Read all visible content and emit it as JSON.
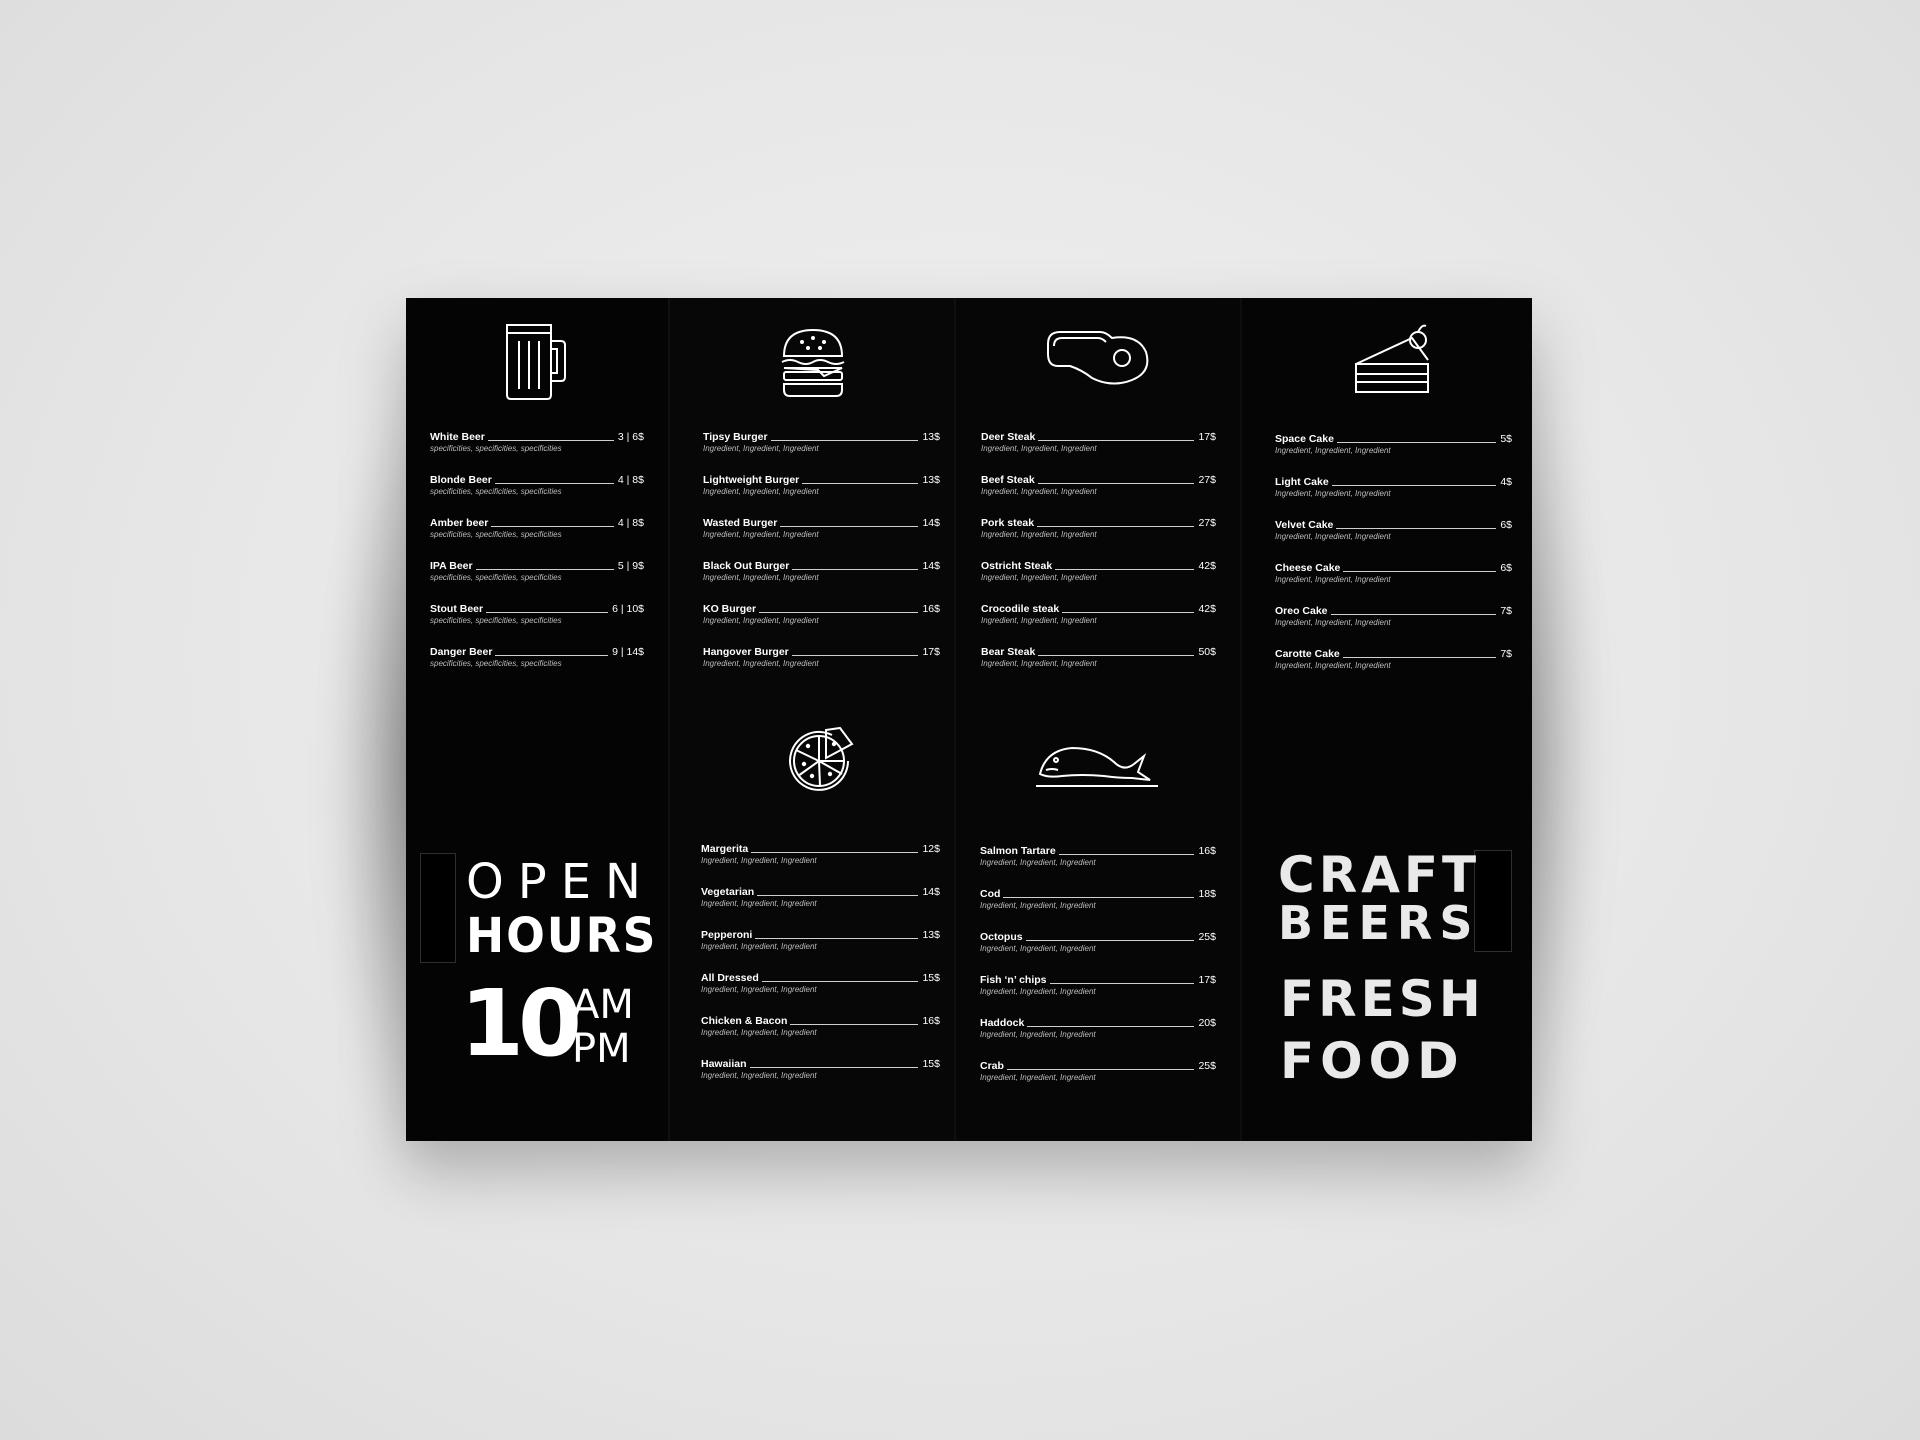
{
  "beers": [
    {
      "name": "White Beer",
      "price": "3 | 6$",
      "desc": "specificities, specificities, specificities"
    },
    {
      "name": "Blonde Beer",
      "price": "4 | 8$",
      "desc": "specificities, specificities, specificities"
    },
    {
      "name": "Amber beer",
      "price": "4 | 8$",
      "desc": "specificities, specificities, specificities"
    },
    {
      "name": "IPA Beer",
      "price": "5 | 9$",
      "desc": "specificities, specificities, specificities"
    },
    {
      "name": "Stout Beer",
      "price": "6 | 10$",
      "desc": "specificities, specificities, specificities"
    },
    {
      "name": "Danger Beer",
      "price": "9 | 14$",
      "desc": "specificities, specificities, specificities"
    }
  ],
  "burgers": [
    {
      "name": "Tipsy Burger",
      "price": "13$",
      "desc": "Ingredient, Ingredient, Ingredient"
    },
    {
      "name": "Lightweight Burger",
      "price": "13$",
      "desc": "Ingredient, Ingredient, Ingredient"
    },
    {
      "name": "Wasted Burger",
      "price": "14$",
      "desc": "Ingredient, Ingredient, Ingredient"
    },
    {
      "name": "Black Out Burger",
      "price": "14$",
      "desc": "Ingredient, Ingredient, Ingredient"
    },
    {
      "name": "KO Burger",
      "price": "16$",
      "desc": "Ingredient, Ingredient, Ingredient"
    },
    {
      "name": "Hangover Burger",
      "price": "17$",
      "desc": "Ingredient, Ingredient, Ingredient"
    }
  ],
  "pizzas": [
    {
      "name": "Margerita",
      "price": "12$",
      "desc": "Ingredient, Ingredient, Ingredient"
    },
    {
      "name": "Vegetarian",
      "price": "14$",
      "desc": "Ingredient, Ingredient, Ingredient"
    },
    {
      "name": "Pepperoni",
      "price": "13$",
      "desc": "Ingredient, Ingredient, Ingredient"
    },
    {
      "name": "All Dressed",
      "price": "15$",
      "desc": "Ingredient, Ingredient, Ingredient"
    },
    {
      "name": "Chicken & Bacon",
      "price": "16$",
      "desc": "Ingredient, Ingredient, Ingredient"
    },
    {
      "name": "Hawaiian",
      "price": "15$",
      "desc": "Ingredient, Ingredient, Ingredient"
    }
  ],
  "steaks": [
    {
      "name": "Deer Steak",
      "price": "17$",
      "desc": "Ingredient, Ingredient, Ingredient"
    },
    {
      "name": "Beef Steak",
      "price": "27$",
      "desc": "Ingredient, Ingredient, Ingredient"
    },
    {
      "name": "Pork steak",
      "price": "27$",
      "desc": "Ingredient, Ingredient, Ingredient"
    },
    {
      "name": "Ostricht Steak",
      "price": "42$",
      "desc": "Ingredient, Ingredient, Ingredient"
    },
    {
      "name": "Crocodile  steak",
      "price": "42$",
      "desc": "Ingredient, Ingredient, Ingredient"
    },
    {
      "name": "Bear Steak",
      "price": "50$",
      "desc": "Ingredient, Ingredient, Ingredient"
    }
  ],
  "fish": [
    {
      "name": "Salmon Tartare",
      "price": "16$",
      "desc": "Ingredient, Ingredient, Ingredient"
    },
    {
      "name": "Cod",
      "price": "18$",
      "desc": "Ingredient, Ingredient, Ingredient"
    },
    {
      "name": "Octopus",
      "price": "25$",
      "desc": "Ingredient, Ingredient, Ingredient"
    },
    {
      "name": "Fish ‘n’ chips",
      "price": "17$",
      "desc": "Ingredient, Ingredient, Ingredient"
    },
    {
      "name": "Haddock",
      "price": "20$",
      "desc": "Ingredient, Ingredient, Ingredient"
    },
    {
      "name": "Crab",
      "price": "25$",
      "desc": "Ingredient, Ingredient, Ingredient"
    }
  ],
  "cakes": [
    {
      "name": "Space Cake",
      "price": "5$",
      "desc": "Ingredient, Ingredient, Ingredient"
    },
    {
      "name": "Light Cake",
      "price": "4$",
      "desc": "Ingredient, Ingredient, Ingredient"
    },
    {
      "name": "Velvet Cake",
      "price": "6$",
      "desc": "Ingredient, Ingredient, Ingredient"
    },
    {
      "name": "Cheese Cake",
      "price": "6$",
      "desc": "Ingredient, Ingredient, Ingredient"
    },
    {
      "name": "Oreo Cake",
      "price": "7$",
      "desc": "Ingredient, Ingredient, Ingredient"
    },
    {
      "name": "Carotte Cake",
      "price": "7$",
      "desc": "Ingredient, Ingredient, Ingredient"
    }
  ],
  "open_hours": {
    "line1": "OPEN",
    "line2": "HOURS",
    "number": "10",
    "am": "AM",
    "pm": "PM"
  },
  "slogan": {
    "line1": "CRAFT",
    "line2": "BEERS",
    "line3": "FRESH",
    "line4": "FOOD"
  },
  "icons": {
    "beer": "beer-mug-icon",
    "burger": "burger-icon",
    "steak": "steak-icon",
    "cake": "cake-slice-icon",
    "pizza": "pizza-icon",
    "fish": "fish-icon"
  },
  "colors": {
    "paper": "#050505",
    "text": "#ffffff",
    "subtext": "#bdbdbd",
    "wall": "#e6e6e6"
  }
}
